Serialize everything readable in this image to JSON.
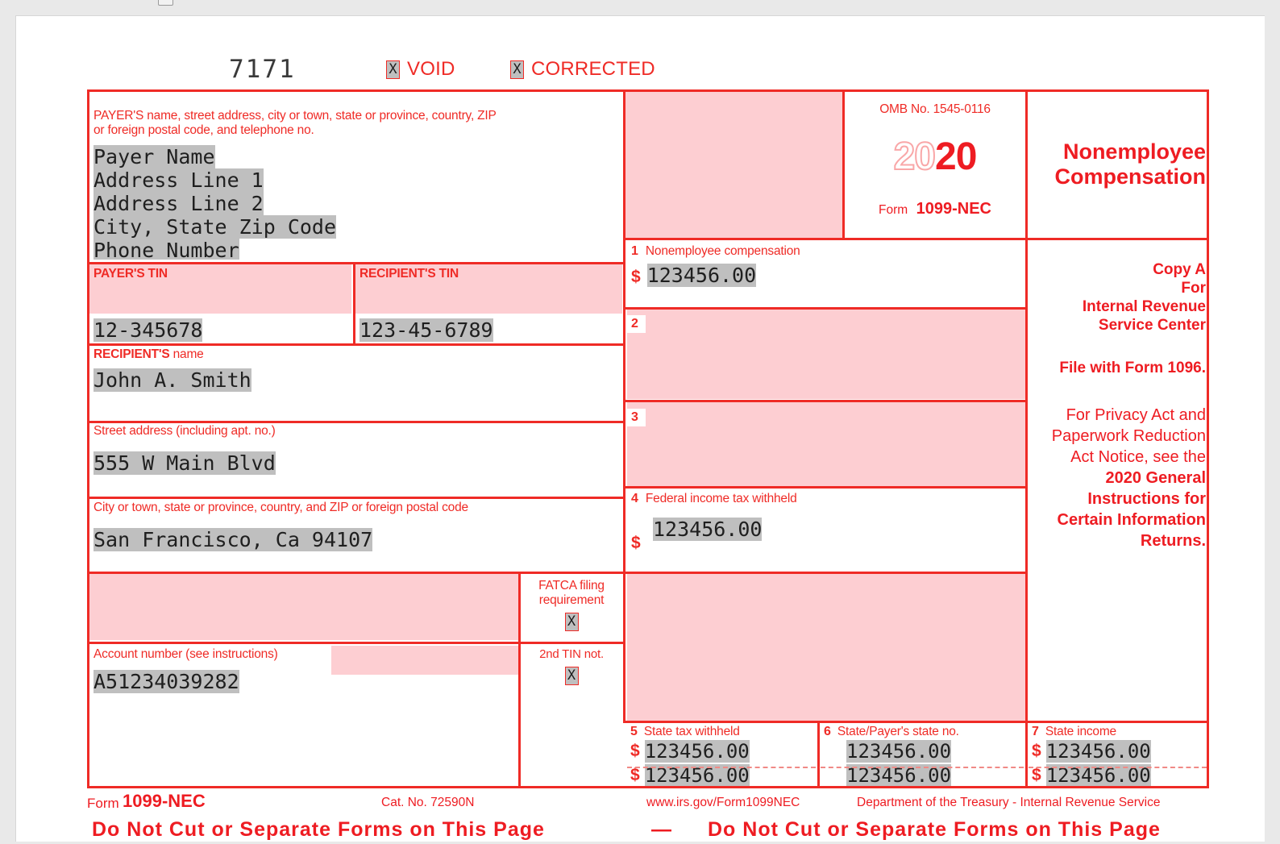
{
  "document": {
    "ocr_line": "7171",
    "form_number": "1099-NEC",
    "form_label": "Form",
    "year_prefix": "20",
    "year_suffix": "20",
    "omb": "OMB No. 1545-0116",
    "title": "Nonemployee Compensation",
    "cat_no": "Cat. No. 72590N",
    "url": "www.irs.gov/Form1099NEC",
    "agency": "Department of the Treasury - Internal Revenue Service",
    "do_not_cut_left": "Do  Not  Cut  or  Separate  Forms  on  This  Page",
    "do_not_cut_dash": "—",
    "do_not_cut_right": "Do  Not  Cut  or  Separate  Forms  on  This  Page"
  },
  "checkboxes": {
    "void": {
      "label": "VOID",
      "mark": "X"
    },
    "corrected": {
      "label": "CORRECTED",
      "mark": "X"
    },
    "fatca": {
      "label_line1": "FATCA filing",
      "label_line2": "requirement",
      "mark": "X"
    },
    "second_tin": {
      "label": "2nd TIN not.",
      "mark": "X"
    }
  },
  "payer": {
    "label": "PAYER'S name, street address, city or town, state or province, country, ZIP or foreign postal code, and telephone no.",
    "label_line1": "PAYER'S name, street address, city or town, state or province, country, ZIP",
    "label_line2": "or foreign postal code, and telephone no.",
    "name": "Payer Name",
    "address1": "Address Line 1",
    "address2": "Address Line 2",
    "city_state_zip": "City, State Zip Code",
    "phone": "Phone Number",
    "tin_label": "PAYER'S TIN",
    "tin": "12-345678"
  },
  "recipient": {
    "tin_label": "RECIPIENT'S TIN",
    "tin": "123-45-6789",
    "name_label_bold": "RECIPIENT'S",
    "name_label_reg": "name",
    "name": "John A. Smith",
    "street_label": "Street address (including apt. no.)",
    "street": "555 W Main Blvd",
    "city_label": "City or town, state or province, country, and ZIP or foreign postal code",
    "city": "San Francisco, Ca 94107",
    "account_label": "Account number (see instructions)",
    "account_number": "A51234039282"
  },
  "boxes": {
    "box1": {
      "num": "1",
      "label": "Nonemployee compensation",
      "dollar": "$",
      "value": "123456.00"
    },
    "box2": {
      "num": "2",
      "label": "",
      "value": ""
    },
    "box3": {
      "num": "3",
      "label": "",
      "value": ""
    },
    "box4": {
      "num": "4",
      "label": "Federal income tax withheld",
      "dollar": "$",
      "value": "123456.00"
    },
    "box5": {
      "num": "5",
      "label": "State tax withheld",
      "dollar": "$",
      "value_row1": "123456.00",
      "value_row2": "123456.00"
    },
    "box6": {
      "num": "6",
      "label": "State/Payer's state no.",
      "value_row1": "123456.00",
      "value_row2": "123456.00"
    },
    "box7": {
      "num": "7",
      "label": "State income",
      "dollar": "$",
      "value_row1": "123456.00",
      "value_row2": "123456.00"
    }
  },
  "copy": {
    "line1": "Copy A",
    "line2": "For",
    "line3": "Internal Revenue",
    "line4": "Service Center",
    "line5": "File with Form 1096.",
    "notice_regular": "For Privacy Act and Paperwork Reduction Act Notice, see the ",
    "notice_bold": "2020 General Instructions for Certain Information Returns."
  },
  "colors": {
    "form_red": "#ef2b26",
    "shade_pink": "#fdced2",
    "value_highlight": "#bfbfbf",
    "page_background": "#e9e9e9"
  }
}
